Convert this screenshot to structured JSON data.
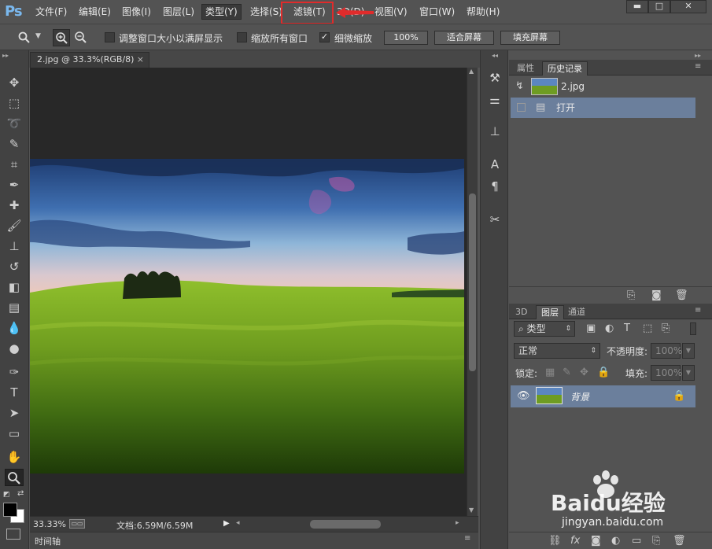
{
  "app": {
    "logo": "Ps"
  },
  "menu": {
    "items": [
      {
        "label": "文件(F)"
      },
      {
        "label": "编辑(E)"
      },
      {
        "label": "图像(I)"
      },
      {
        "label": "图层(L)"
      },
      {
        "label": "类型(Y)"
      },
      {
        "label": "选择(S)"
      },
      {
        "label": "滤镜(T)"
      },
      {
        "label": "3D(D)"
      },
      {
        "label": "视图(V)"
      },
      {
        "label": "窗口(W)"
      },
      {
        "label": "帮助(H)"
      }
    ],
    "highlighted": "滤镜(T)",
    "highlight_color": "#e02b2b"
  },
  "window_controls": {
    "minimize": "▬",
    "maximize": "□",
    "close": "✕"
  },
  "options": {
    "resize_windows": {
      "label": "调整窗口大小以满屏显示",
      "checked": false
    },
    "zoom_all_windows": {
      "label": "缩放所有窗口",
      "checked": false
    },
    "scrubby_zoom": {
      "label": "细微缩放",
      "checked": true
    },
    "btn_100": "100%",
    "btn_fit": "适合屏幕",
    "btn_fill": "填充屏幕"
  },
  "document": {
    "tab_title": "2.jpg @ 33.3%(RGB/8)",
    "close": "×",
    "zoom": "33.33%",
    "doc_info": "文档:6.59M/6.59M",
    "timeline": "时间轴"
  },
  "history_panel": {
    "tabs": [
      "属性",
      "历史记录"
    ],
    "active_tab": "历史记录",
    "snapshot": "2.jpg",
    "states": [
      "打开"
    ]
  },
  "layers_panel": {
    "tabs": [
      "3D",
      "图层",
      "通道"
    ],
    "active_tab": "图层",
    "filter_kind": "类型",
    "blend_mode": "正常",
    "opacity_label": "不透明度:",
    "opacity_value": "100%",
    "lock_label": "锁定:",
    "fill_label": "填充:",
    "fill_value": "100%",
    "layers": [
      {
        "name": "背景",
        "visible": true,
        "locked": true
      }
    ]
  },
  "watermark": {
    "brand": "Baidu经验",
    "url": "jingyan.baidu.com"
  },
  "colors": {
    "accent_selection": "#6b7f9c",
    "ui_bg": "#535353"
  }
}
